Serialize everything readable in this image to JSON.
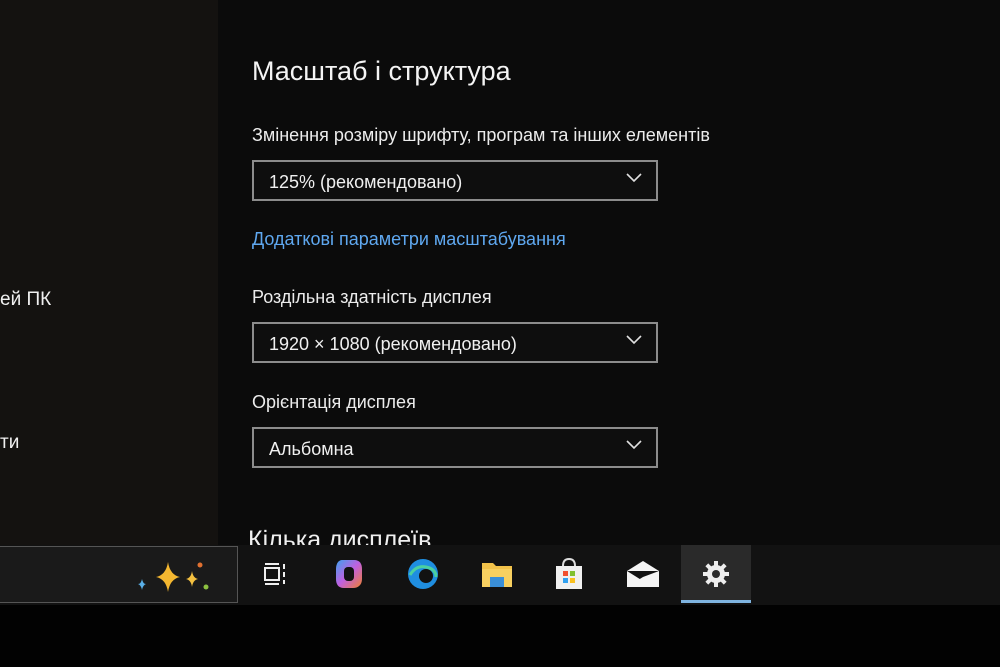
{
  "sidebar": {
    "items": [
      {
        "label": "ей ПК"
      },
      {
        "label": "ти"
      }
    ]
  },
  "main": {
    "section_title": "Масштаб і структура",
    "scale": {
      "label": "Змінення розміру шрифту, програм та інших елементів",
      "value": "125% (рекомендовано)"
    },
    "advanced_link": "Додаткові параметри масштабування",
    "resolution": {
      "label": "Роздільна здатність дисплея",
      "value": "1920 × 1080 (рекомендовано)"
    },
    "orientation": {
      "label": "Орієнтація дисплея",
      "value": "Альбомна"
    },
    "next_section_title": "Кілька дисплеїв"
  },
  "taskbar": {
    "items": [
      "task-view-icon",
      "copilot-icon",
      "edge-icon",
      "file-explorer-icon",
      "store-icon",
      "mail-icon",
      "settings-icon"
    ],
    "active": "settings-icon",
    "accent": "#7fb4e0"
  }
}
